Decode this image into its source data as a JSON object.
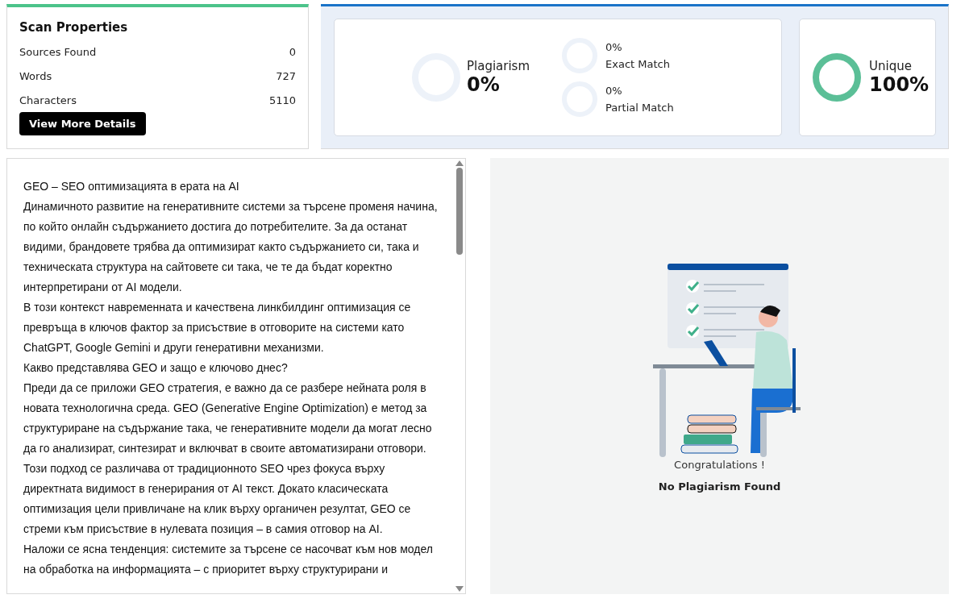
{
  "scan_properties": {
    "title": "Scan Properties",
    "rows": [
      {
        "label": "Sources Found",
        "value": "0"
      },
      {
        "label": "Words",
        "value": "727"
      },
      {
        "label": "Characters",
        "value": "5110"
      }
    ],
    "button": "View More Details"
  },
  "results": {
    "plagiarism": {
      "label": "Plagiarism",
      "value": "0%",
      "color": "#edf2f9"
    },
    "matches": [
      {
        "value": "0%",
        "label": "Exact Match",
        "color": "#edf2f9"
      },
      {
        "value": "0%",
        "label": "Partial Match",
        "color": "#edf2f9"
      }
    ],
    "unique": {
      "label": "Unique",
      "value": "100%",
      "color": "#5bbf97"
    }
  },
  "document": {
    "paragraphs": [
      "GEO – SEO оптимизацията в ерата на AI",
      "Динамичното развитие на генеративните системи за търсене променя начина, по който онлайн съдържанието достига до потребителите. За да останат видими, брандовете трябва да оптимизират както съдържанието си, така и техническата структура на сайтовете си така, че те да бъдат коректно интерпретирани от AI модели.",
      "В този контекст навременната и качествена линкбилдинг оптимизация се превръща в ключов фактор за присъствие в отговорите на системи като ChatGPT, Google Gemini и други генеративни механизми.",
      "Какво представлява GEO и защо е ключово днес?",
      "Преди да се приложи GEO стратегия, е важно да се разбере нейната роля в новата технологична среда. GEO (Generative Engine Optimization) е метод за структуриране на съдържание така, че генеративните модели да могат лесно да го анализират, синтезират и включват в своите автоматизирани отговори.",
      "Този подход се различава от традиционното SEO чрез фокуса върху директната видимост в генерирания от AI текст. Докато класическата оптимизация цели привличане на клик върху органичен резултат, GEO се стреми към присъствие в нулевата позиция – в самия отговор на AI.",
      "Наложи се ясна тенденция: системите за търсене се насочват към нов модел на обработка на информацията – с приоритет върху структурирани и"
    ]
  },
  "result_panel": {
    "title": "Congratulations !",
    "message": "No Plagiarism Found"
  }
}
